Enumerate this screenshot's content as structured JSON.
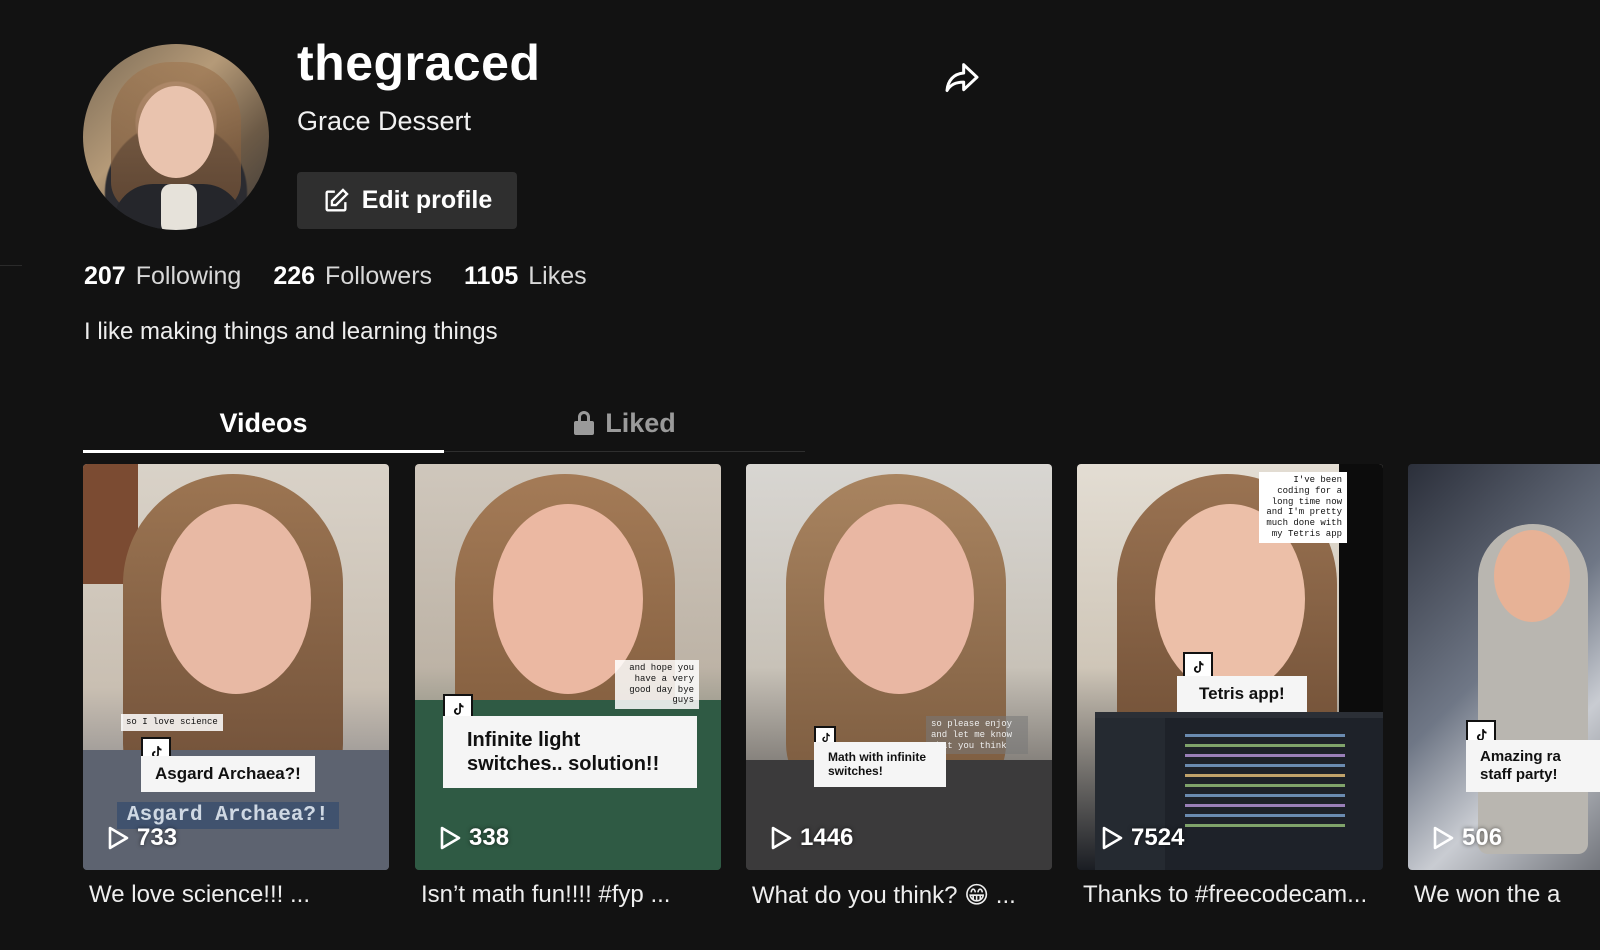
{
  "profile": {
    "username": "thegraced",
    "display_name": "Grace Dessert",
    "edit_button_label": "Edit profile",
    "bio": "I like making things and learning things"
  },
  "stats": [
    {
      "value": "207",
      "label": "Following"
    },
    {
      "value": "226",
      "label": "Followers"
    },
    {
      "value": "1105",
      "label": "Likes"
    }
  ],
  "tabs": {
    "videos": "Videos",
    "liked": "Liked"
  },
  "videos": [
    {
      "views": "733",
      "caption": "We love science!!! ...",
      "overlay": "Asgard Archaea?!",
      "subtitle": "Asgard Archaea?!",
      "small": "so I love science"
    },
    {
      "views": "338",
      "caption": "Isn’t math fun!!!! #fyp ...",
      "overlay_line1": "Infinite light",
      "overlay_line2": "switches.. solution!!",
      "small": "and hope you have a very good day bye guys"
    },
    {
      "views": "1446",
      "caption": "What do you think? 😁 ...",
      "overlay_line1": "Math with infinite",
      "overlay_line2": "switches!",
      "small": "so please enjoy and let me know what you think"
    },
    {
      "views": "7524",
      "caption": "Thanks to #freecodecam...",
      "overlay": "Tetris app!",
      "small": "I've been coding for a long time now and I'm pretty much done with my Tetris app"
    },
    {
      "views": "506",
      "caption": "We won the a",
      "overlay_line1": "Amazing ra",
      "overlay_line2": "staff party!"
    }
  ]
}
